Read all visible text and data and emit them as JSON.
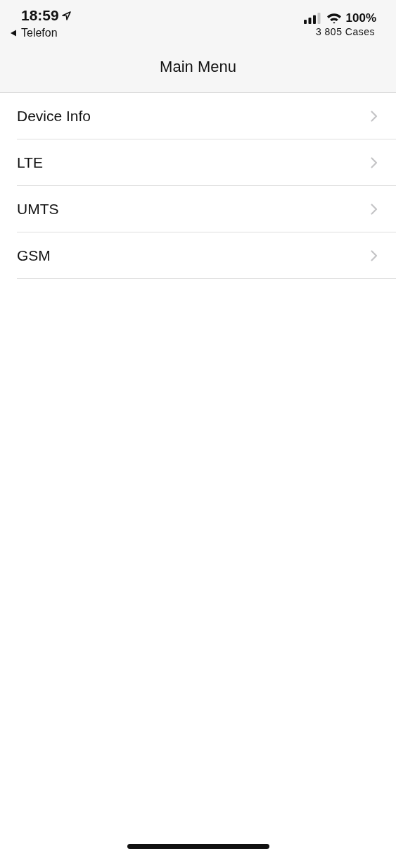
{
  "status_bar": {
    "time": "18:59",
    "back_link": "Telefon",
    "battery": "100%",
    "carrier_note": "3 805 Cases"
  },
  "navigation_bar": {
    "title": "Main Menu"
  },
  "menu": [
    {
      "label": "Device Info"
    },
    {
      "label": "LTE"
    },
    {
      "label": "UMTS"
    },
    {
      "label": "GSM"
    }
  ]
}
